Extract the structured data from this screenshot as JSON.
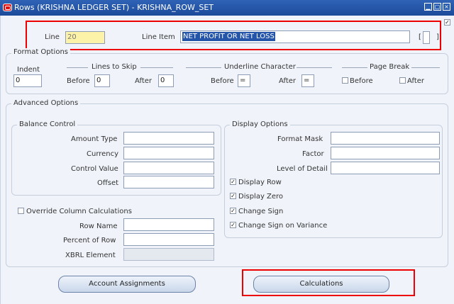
{
  "window": {
    "title": "Rows (KRISHNA LEDGER SET) - KRISHNA_ROW_SET"
  },
  "row": {
    "line_label": "Line",
    "line_value": "20",
    "line_item_label": "Line Item",
    "line_item_value": "NET PROFIT OR NET LOSS",
    "bracket_open": "[",
    "bracket_close": "]"
  },
  "format_options": {
    "title": "Format Options",
    "indent_label": "Indent",
    "indent_value": "0",
    "lines_to_skip_title": "Lines to Skip",
    "before_label": "Before",
    "before_value": "0",
    "after_label": "After",
    "after_value": "0",
    "underline_title": "Underline Character",
    "ul_before_label": "Before",
    "ul_before_value": "=",
    "ul_after_label": "After",
    "ul_after_value": "=",
    "page_break_title": "Page Break",
    "pb_before_label": "Before",
    "pb_after_label": "After"
  },
  "advanced_options": {
    "title": "Advanced Options",
    "balance_control": {
      "title": "Balance Control",
      "amount_type_label": "Amount Type",
      "currency_label": "Currency",
      "control_value_label": "Control Value",
      "offset_label": "Offset"
    },
    "override_label": "Override Column Calculations",
    "row_name_label": "Row Name",
    "percent_of_row_label": "Percent of Row",
    "xbrl_label": "XBRL Element",
    "display_options": {
      "title": "Display Options",
      "format_mask_label": "Format Mask",
      "factor_label": "Factor",
      "level_of_detail_label": "Level of Detail",
      "checks": [
        {
          "label": "Display Row",
          "checked": true
        },
        {
          "label": "Display Zero",
          "checked": true
        },
        {
          "label": "Change Sign",
          "checked": true
        },
        {
          "label": "Change Sign on Variance",
          "checked": true
        }
      ]
    }
  },
  "buttons": {
    "account_assignments": "Account Assignments",
    "calculations": "Calculations"
  },
  "colors": {
    "highlight_box": "#e00000",
    "title_bar": "#2455a8",
    "line_field": "#fdf3a8"
  }
}
